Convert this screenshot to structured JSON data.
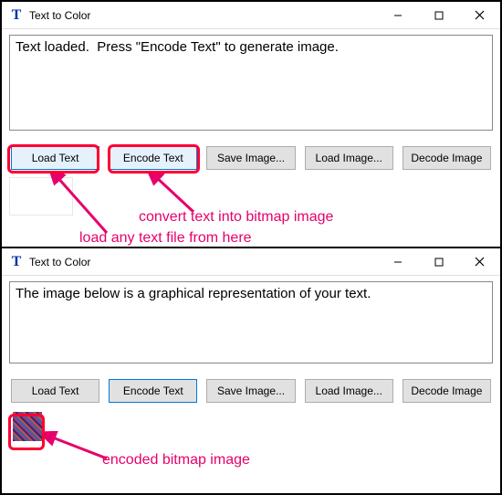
{
  "top_window": {
    "title": "Text to Color",
    "message": "Text loaded.  Press \"Encode Text\" to generate image.",
    "buttons": {
      "load_text": "Load Text",
      "encode_text": "Encode Text",
      "save_image": "Save Image...",
      "load_image": "Load Image...",
      "decode_image": "Decode Image"
    }
  },
  "bottom_window": {
    "title": "Text to Color",
    "message": "The image below is a graphical representation of your text.",
    "buttons": {
      "load_text": "Load Text",
      "encode_text": "Encode Text",
      "save_image": "Save Image...",
      "load_image": "Load Image...",
      "decode_image": "Decode Image"
    }
  },
  "annotations": {
    "convert": "convert text into bitmap image",
    "load": "load any text file from here",
    "encoded": "encoded bitmap image"
  },
  "colors": {
    "highlight": "#ff0033",
    "anno_text": "#e6006b"
  }
}
